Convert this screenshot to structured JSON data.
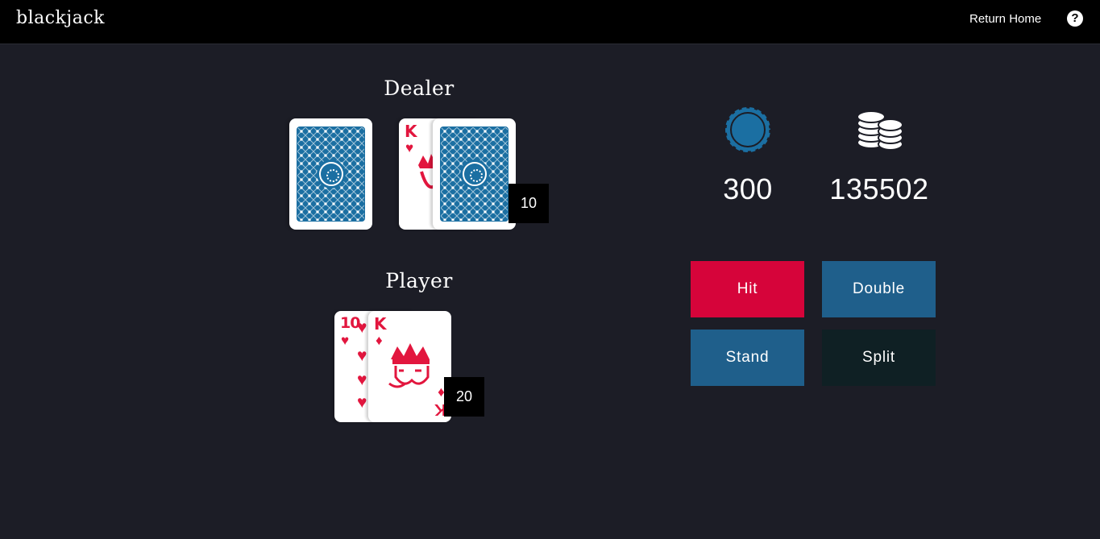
{
  "header": {
    "brand": "blackjack",
    "return_home": "Return Home",
    "help_glyph": "?"
  },
  "dealer": {
    "title": "Dealer",
    "score": "10",
    "cards": [
      {
        "face": "back"
      },
      {
        "face": "up",
        "rank": "K",
        "suit": "♥",
        "suit_name": "hearts"
      },
      {
        "face": "back"
      }
    ]
  },
  "player": {
    "title": "Player",
    "score": "20",
    "cards": [
      {
        "face": "up",
        "rank": "10",
        "suit": "♥",
        "suit_name": "hearts"
      },
      {
        "face": "up",
        "rank": "K",
        "suit": "♦",
        "suit_name": "diamonds"
      }
    ]
  },
  "stats": {
    "bet": {
      "icon": "poker-chip-icon",
      "value": "300"
    },
    "balance": {
      "icon": "coin-stacks-icon",
      "value": "135502"
    }
  },
  "actions": {
    "hit": "Hit",
    "double": "Double",
    "stand": "Stand",
    "split": "Split"
  },
  "colors": {
    "background": "#1c1d26",
    "topbar": "#000000",
    "hit": "#d6043a",
    "double": "#1f5f8b",
    "stand": "#1f5f8b",
    "split": "#0f2024",
    "chip": "#1b6fa2",
    "card_back": "#1b6fa2",
    "card_red": "#e2163e"
  }
}
